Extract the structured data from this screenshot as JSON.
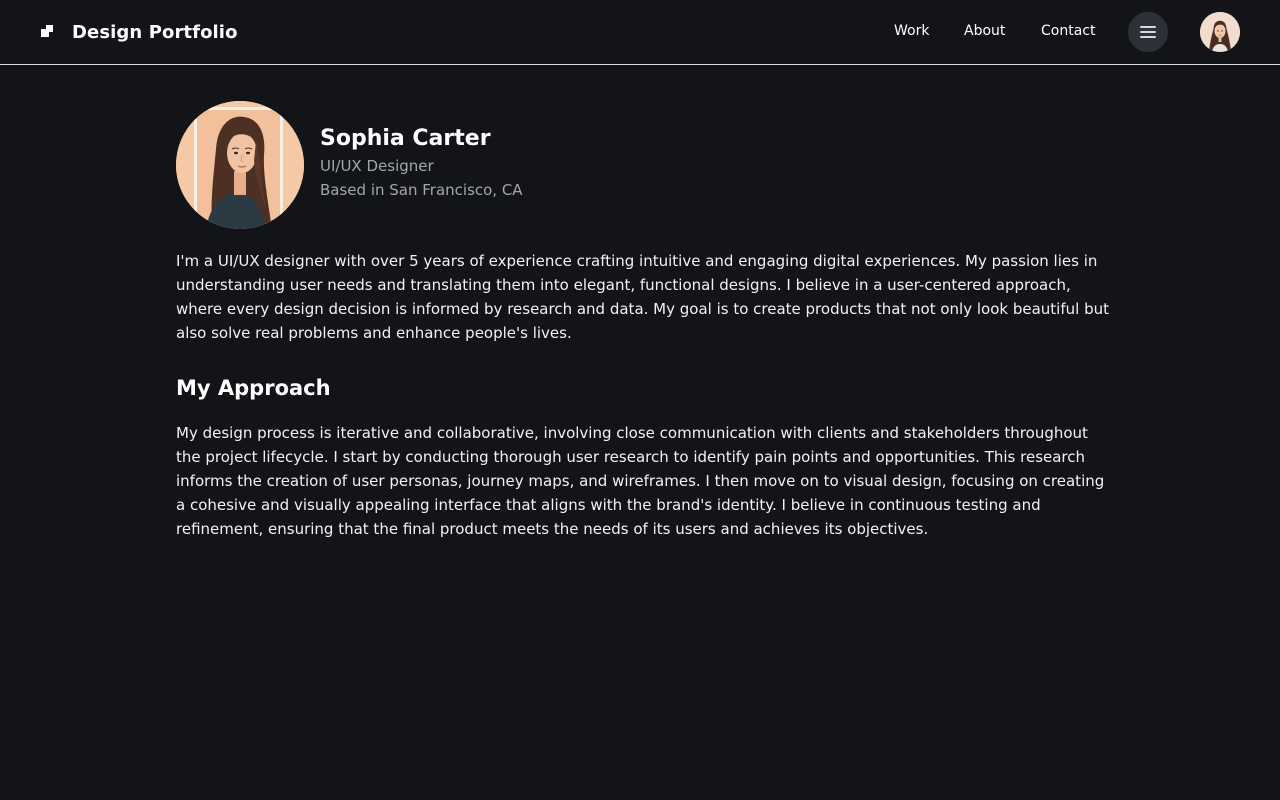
{
  "header": {
    "brand_title": "Design Portfolio",
    "nav": [
      {
        "label": "Work"
      },
      {
        "label": "About"
      },
      {
        "label": "Contact"
      }
    ],
    "menu_icon": "hamburger-icon",
    "avatar": "user-avatar"
  },
  "profile": {
    "name": "Sophia Carter",
    "role": "UI/UX Designer",
    "location": "Based in San Francisco, CA"
  },
  "bio": "I'm a UI/UX designer with over 5 years of experience crafting intuitive and engaging digital experiences. My passion lies in understanding user needs and translating them into elegant, functional designs. I believe in a user-centered approach, where every design decision is informed by research and data. My goal is to create products that not only look beautiful but also solve real problems and enhance people's lives.",
  "approach": {
    "heading": "My Approach",
    "text": "My design process is iterative and collaborative, involving close communication with clients and stakeholders throughout the project lifecycle. I start by conducting thorough user research to identify pain points and opportunities. This research informs the creation of user personas, journey maps, and wireframes. I then move on to visual design, focusing on creating a cohesive and visually appealing interface that aligns with the brand's identity. I believe in continuous testing and refinement, ensuring that the final product meets the needs of its users and achieves its objectives."
  },
  "colors": {
    "background": "#131418",
    "header_border": "#dcdcdc",
    "muted_text": "#a3a6ad",
    "menu_button_bg": "#2d3036"
  }
}
